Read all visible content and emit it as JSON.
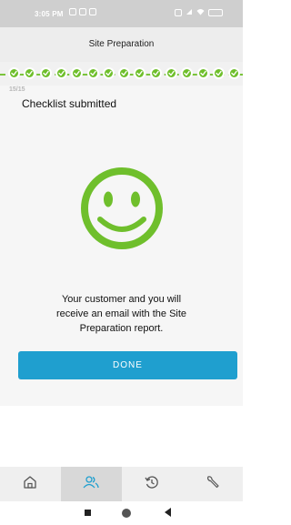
{
  "status_bar": {
    "time": "3:05 PM",
    "left_icons": [
      "message-icon",
      "mail-icon",
      "notification-icon"
    ],
    "right_icons": [
      "alarm-icon",
      "signal-icon",
      "wifi-icon",
      "battery-icon"
    ]
  },
  "header": {
    "title": "Site Preparation"
  },
  "progress": {
    "counter": "15/15",
    "completed_steps": 15,
    "total_steps": 15,
    "accent_color": "#6fbf2c"
  },
  "main": {
    "status_title": "Checklist submitted",
    "illustration": "smiley-face-icon",
    "message_lines": [
      "Your customer and you will",
      "receive an email with the Site",
      "Preparation report."
    ],
    "done_label": "DONE",
    "button_color": "#1f9fcf"
  },
  "bottom_nav": {
    "items": [
      {
        "icon": "home-icon"
      },
      {
        "icon": "customers-icon"
      },
      {
        "icon": "history-icon"
      },
      {
        "icon": "tools-icon"
      }
    ]
  },
  "system_nav": {
    "icons": [
      "recents-icon",
      "home-circle-icon",
      "back-icon"
    ]
  }
}
